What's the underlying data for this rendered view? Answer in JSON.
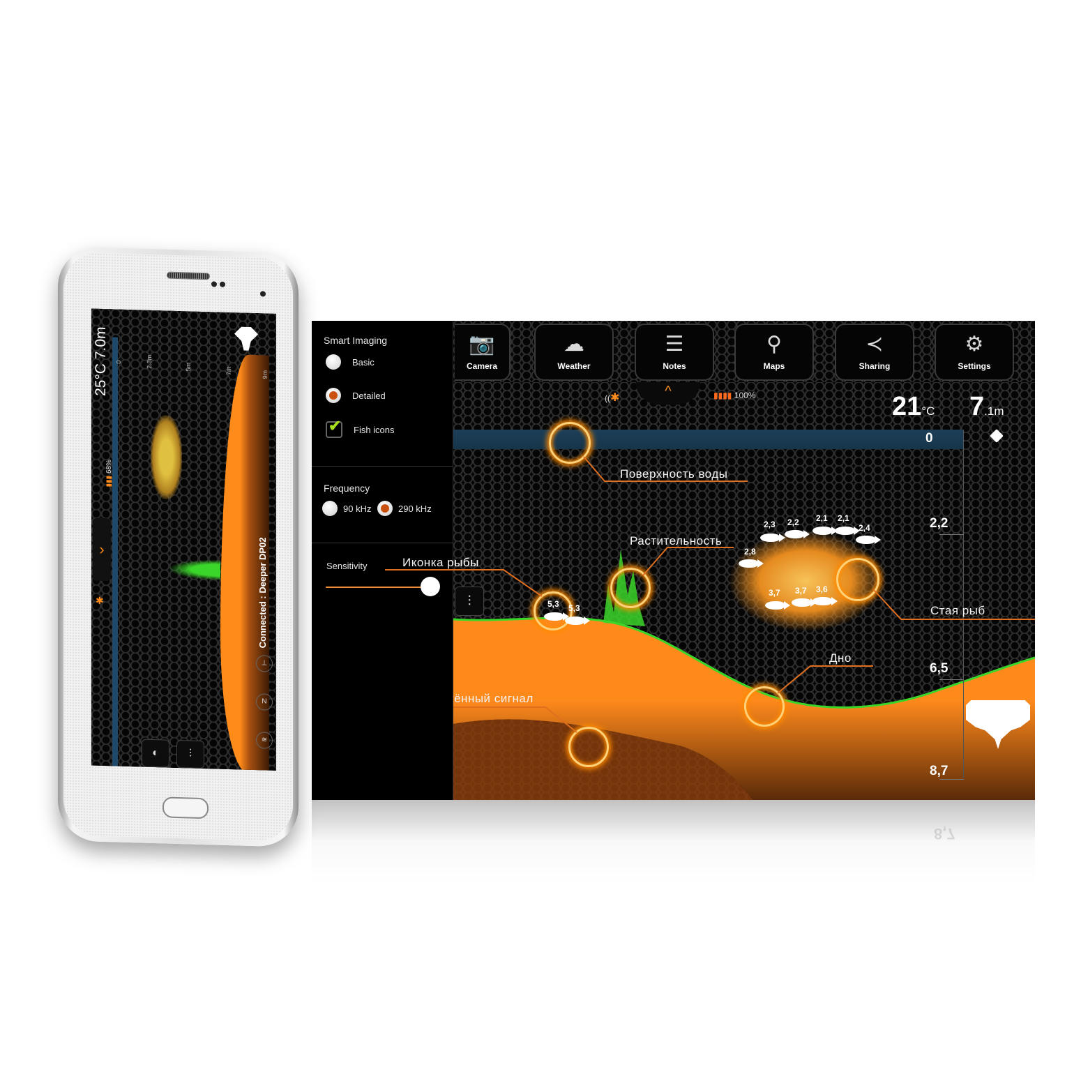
{
  "phone": {
    "temperature": "25°C",
    "depth": "7.0m",
    "battery": "68%",
    "depth_ticks": [
      "0",
      "2.3m",
      "5m",
      "7m",
      "9m"
    ],
    "connection_status": "Connected : Deeper DP02",
    "chevron": "›",
    "bluetooth_icon": "bluetooth",
    "side_icons": [
      "signal-tower-icon",
      "north-arrow-icon",
      "wifi-signal-icon"
    ],
    "side_icon_glyphs": [
      "⊥",
      "N",
      "≋"
    ],
    "buttons": [
      {
        "name": "view-mode-button",
        "glyph": "◐"
      },
      {
        "name": "equalizer-button",
        "glyph": "⫶"
      }
    ]
  },
  "tablet": {
    "sidebar": {
      "smart_imaging": {
        "title": "Smart Imaging",
        "options": [
          {
            "label": "Basic",
            "selected": false
          },
          {
            "label": "Detailed",
            "selected": true
          }
        ],
        "fish_icons": {
          "label": "Fish icons",
          "checked": true
        }
      },
      "frequency": {
        "title": "Frequency",
        "options": [
          {
            "label": "90 kHz",
            "selected": false
          },
          {
            "label": "290 kHz",
            "selected": true
          }
        ]
      },
      "sensitivity": {
        "title": "Sensitivity",
        "value_percent": 100
      }
    },
    "toolbar": [
      {
        "label": "Camera",
        "icon": "camera-icon",
        "glyph": "📷"
      },
      {
        "label": "Weather",
        "icon": "weather-icon",
        "glyph": "☁"
      },
      {
        "label": "Notes",
        "icon": "notes-icon",
        "glyph": "☰"
      },
      {
        "label": "Maps",
        "icon": "map-pin-icon",
        "glyph": "⚲"
      },
      {
        "label": "Sharing",
        "icon": "share-icon",
        "glyph": "≺"
      },
      {
        "label": "Settings",
        "icon": "gear-icon",
        "glyph": "⚙"
      }
    ],
    "status": {
      "battery": "100%",
      "pull_tab": "^",
      "temperature_value": "21",
      "temperature_unit": "°C",
      "depth_value": "7",
      "depth_unit": ".1m"
    },
    "depth_scale": [
      "0",
      "2,2",
      "6,5",
      "8,7"
    ],
    "fish": [
      {
        "depth": "5,3"
      },
      {
        "depth": "5,3"
      },
      {
        "depth": "2,3"
      },
      {
        "depth": "2,2"
      },
      {
        "depth": "2,1"
      },
      {
        "depth": "2,1"
      },
      {
        "depth": "2,4"
      },
      {
        "depth": "2,8"
      },
      {
        "depth": "3,7"
      },
      {
        "depth": "3,7"
      },
      {
        "depth": "3,6"
      }
    ],
    "callouts": {
      "water_surface": "Поверхность воды",
      "vegetation": "Растительность",
      "fish_icon": "Иконка рыбы",
      "fish_school": "Стая рыб",
      "bottom": "Дно",
      "secondary_echo": "Вторичный отражённый сигнал"
    },
    "reflection_text": "8,7"
  },
  "colors": {
    "accent_orange": "#ff8a1c",
    "selected_radio": "#c9500f",
    "surface_blue": "#1d3f58",
    "vegetation_green": "#3bd62a",
    "checkmark_green": "#a8e020"
  }
}
